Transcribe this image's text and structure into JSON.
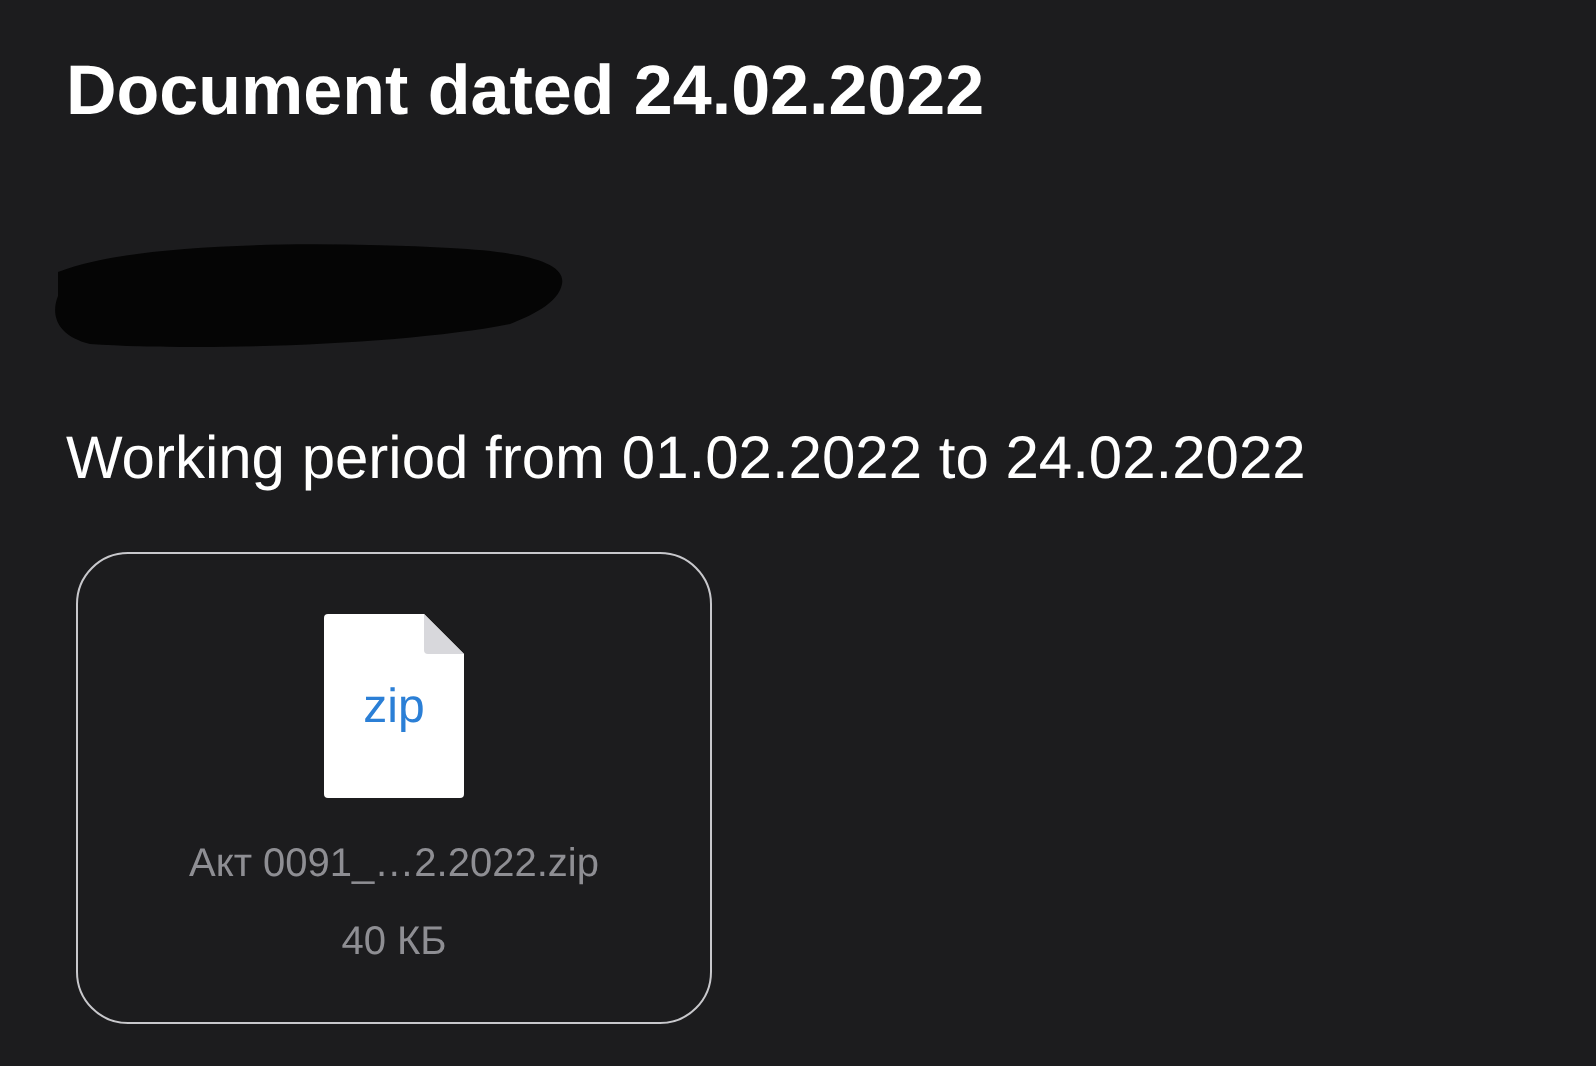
{
  "title": "Document dated 24.02.2022",
  "subtitle": "Working period from 01.02.2022 to 24.02.2022",
  "attachment": {
    "type_label": "zip",
    "filename": "Акт 0091_…2.2022.zip",
    "size": "40 КБ"
  }
}
